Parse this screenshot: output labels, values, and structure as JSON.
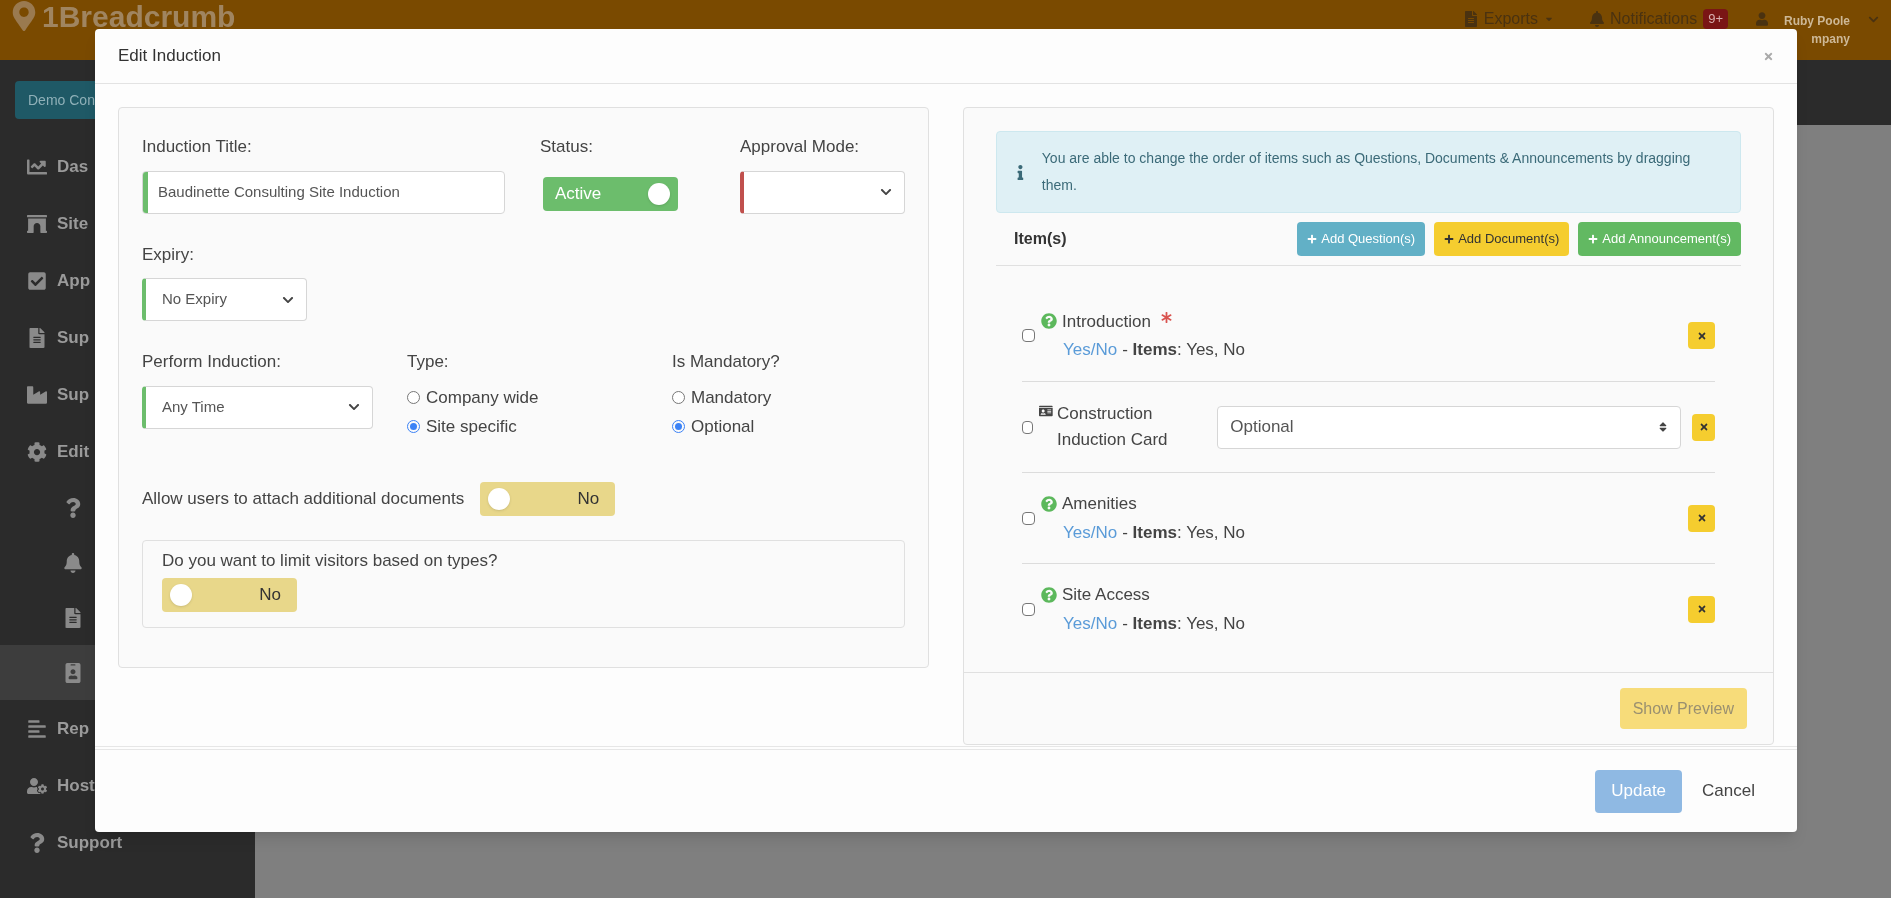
{
  "header": {
    "logo": "1Breadcrumb",
    "exports": "Exports",
    "notifications": "Notifications",
    "notification_count": "9+",
    "user_name": "Ruby Poole",
    "user_company": "mpany"
  },
  "sidebar": {
    "company_button": "Demo Con",
    "items": [
      {
        "kind": "dashboard",
        "label": "Das",
        "selected": false
      },
      {
        "kind": "sites",
        "label": "Site",
        "selected": false
      },
      {
        "kind": "approvals",
        "label": "App",
        "selected": false
      },
      {
        "kind": "documents",
        "label": "Sup",
        "selected": false
      },
      {
        "kind": "suppliers",
        "label": "Sup",
        "selected": false
      },
      {
        "kind": "editor",
        "label": "Edit",
        "selected": false,
        "children": [
          {
            "kind": "question",
            "selected": false
          },
          {
            "kind": "bell",
            "selected": false
          },
          {
            "kind": "documents",
            "selected": false
          },
          {
            "kind": "badge",
            "selected": true
          }
        ]
      },
      {
        "kind": "reports",
        "label": "Rep",
        "selected": false
      },
      {
        "kind": "host",
        "label": "Host",
        "selected": false
      },
      {
        "kind": "question",
        "label": "Support",
        "selected": false
      }
    ]
  },
  "modal": {
    "title": "Edit Induction",
    "form": {
      "induction_title": {
        "label": "Induction Title:",
        "value": "Baudinette Consulting Site Induction",
        "valid": true
      },
      "status": {
        "label": "Status:",
        "toggle": {
          "text": "Active",
          "on": true
        }
      },
      "approval_mode": {
        "label": "Approval Mode:",
        "valid": false
      },
      "expiry": {
        "label": "Expiry:",
        "value": "No Expiry",
        "valid": true
      },
      "perform_induction": {
        "label": "Perform Induction:",
        "value": "Any Time",
        "valid": true
      },
      "type": {
        "label": "Type:",
        "options": [
          {
            "label": "Company wide",
            "selected": false
          },
          {
            "label": "Site specific",
            "selected": true
          }
        ]
      },
      "is_mandatory": {
        "label": "Is Mandatory?",
        "options": [
          {
            "label": "Mandatory",
            "selected": false
          },
          {
            "label": "Optional",
            "selected": true
          }
        ]
      },
      "attach_documents": {
        "label": "Allow users to attach additional documents",
        "toggle": {
          "text": "No",
          "on": false
        }
      },
      "limit_visitors": {
        "label": "Do you want to limit visitors based on types?",
        "toggle": {
          "text": "No",
          "on": false
        }
      }
    },
    "items_panel": {
      "info": "You are able to change the order of items such as Questions, Documents & Announcements by dragging them.",
      "heading": "Item(s)",
      "buttons": [
        {
          "kind": "question",
          "label": "Add Question(s)"
        },
        {
          "kind": "document",
          "label": "Add Document(s)"
        },
        {
          "kind": "announcement",
          "label": "Add Announcement(s)"
        }
      ],
      "items": [
        {
          "kind": "question",
          "title": "Introduction",
          "required": true,
          "checked": false,
          "type_link": "Yes/No",
          "detail": "- **Items**: Yes, No"
        },
        {
          "kind": "document",
          "title": "Construction Induction Card",
          "checked": false,
          "select": "Optional"
        },
        {
          "kind": "question",
          "title": "Amenities",
          "required": false,
          "checked": false,
          "type_link": "Yes/No",
          "detail": "- **Items**: Yes, No"
        },
        {
          "kind": "question",
          "title": "Site Access",
          "required": false,
          "checked": false,
          "type_link": "Yes/No",
          "detail": "- **Items**: Yes, No"
        }
      ],
      "preview_button": {
        "label": "Show Preview",
        "disabled": true
      }
    },
    "footer": {
      "update": {
        "label": "Update",
        "disabled": true
      },
      "cancel": "Cancel"
    }
  }
}
